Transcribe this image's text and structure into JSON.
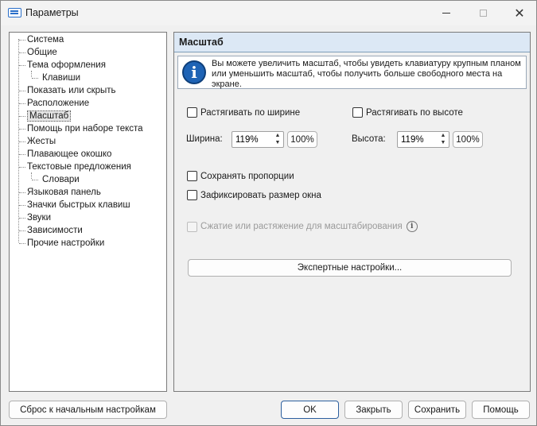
{
  "window": {
    "title": "Параметры",
    "close_glyph": "✕"
  },
  "tree": {
    "items": [
      {
        "label": "Система",
        "level": 0
      },
      {
        "label": "Общие",
        "level": 0
      },
      {
        "label": "Тема оформления",
        "level": 0
      },
      {
        "label": "Клавиши",
        "level": 1
      },
      {
        "label": "Показать или скрыть",
        "level": 0
      },
      {
        "label": "Расположение",
        "level": 0
      },
      {
        "label": "Масштаб",
        "level": 0,
        "selected": true
      },
      {
        "label": "Помощь при наборе текста",
        "level": 0
      },
      {
        "label": "Жесты",
        "level": 0
      },
      {
        "label": "Плавающее окошко",
        "level": 0
      },
      {
        "label": "Текстовые предложения",
        "level": 0
      },
      {
        "label": "Словари",
        "level": 1
      },
      {
        "label": "Языковая панель",
        "level": 0
      },
      {
        "label": "Значки быстрых клавиш",
        "level": 0
      },
      {
        "label": "Звуки",
        "level": 0
      },
      {
        "label": "Зависимости",
        "level": 0
      },
      {
        "label": "Прочие настройки",
        "level": 0
      }
    ]
  },
  "panel": {
    "title": "Масштаб",
    "info_text": "Вы можете увеличить масштаб, чтобы увидеть клавиатуру крупным планом или уменьшить масштаб, чтобы получить больше свободного места на экране.",
    "info_icon_glyph": "i",
    "stretch_width_label": "Растягивать по ширине",
    "stretch_height_label": "Растягивать по высоте",
    "width_label": "Ширина:",
    "width_value": "119%",
    "width_reset": "100%",
    "height_label": "Высота:",
    "height_value": "119%",
    "height_reset": "100%",
    "keep_proportions_label": "Сохранять пропорции",
    "fix_size_label": "Зафиксировать размер окна",
    "scale_compress_label": "Сжатие или растяжение для масштабирования",
    "scale_info_glyph": "i",
    "expert_button": "Экспертные настройки..."
  },
  "footer": {
    "reset_button": "Сброс к начальным настройкам",
    "ok_button": "OK",
    "close_button": "Закрыть",
    "save_button": "Сохранить",
    "help_button": "Помощь"
  },
  "colors": {
    "accent": "#2c5f9e",
    "header_bg": "#dce8f5",
    "info_icon": "#1e63b5"
  }
}
